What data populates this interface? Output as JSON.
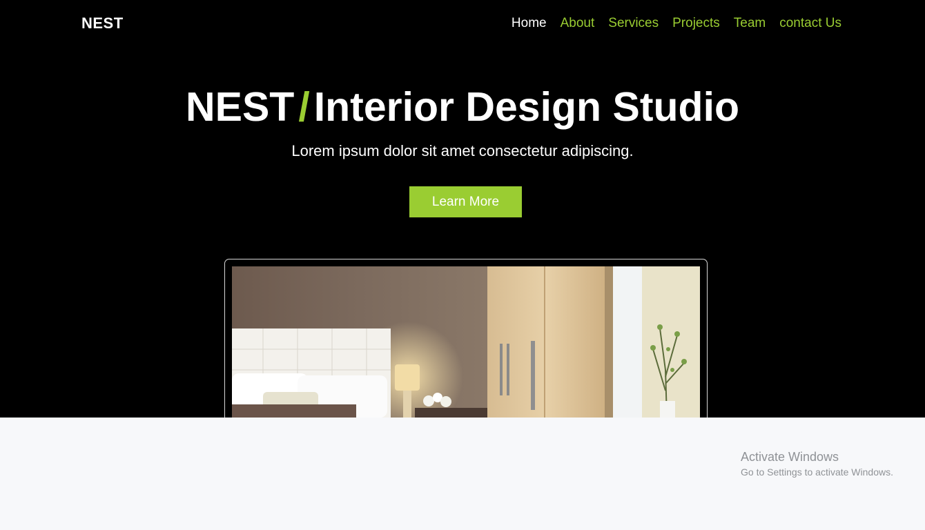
{
  "brand": "NEST",
  "nav": {
    "items": [
      {
        "label": "Home",
        "active": true
      },
      {
        "label": "About",
        "active": false
      },
      {
        "label": "Services",
        "active": false
      },
      {
        "label": "Projects",
        "active": false
      },
      {
        "label": "Team",
        "active": false
      },
      {
        "label": "contact Us",
        "active": false
      }
    ]
  },
  "hero": {
    "title_main": "NEST",
    "title_slash": "/",
    "title_rest": "Interior Design Studio",
    "subtitle": "Lorem ipsum dolor sit amet consectetur adipiscing.",
    "cta_label": "Learn More"
  },
  "colors": {
    "accent": "#9acd32",
    "background": "#000000",
    "text": "#ffffff",
    "lower_section": "#f7f8fa"
  },
  "watermark": {
    "title": "Activate Windows",
    "subtitle": "Go to Settings to activate Windows."
  }
}
